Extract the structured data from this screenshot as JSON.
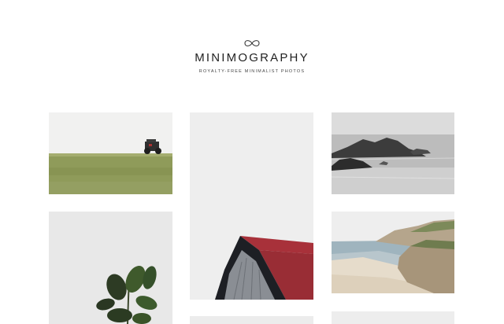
{
  "site": {
    "title": "MINIMOGRAPHY",
    "tagline": "ROYALTY-FREE MINIMALIST PHOTOS",
    "logo_icon": "infinity-icon"
  },
  "gallery": {
    "photos": [
      {
        "subject": "tractor-on-grass-field"
      },
      {
        "subject": "red-roof-barn"
      },
      {
        "subject": "rocks-in-sea"
      },
      {
        "subject": "fiddle-leaf-plant"
      },
      {
        "subject": "coastal-cliffs-beach"
      }
    ]
  },
  "colors": {
    "background": "#ffffff",
    "text": "#222222",
    "barn_roof": "#a8313a",
    "grass": "#8e9a57"
  }
}
